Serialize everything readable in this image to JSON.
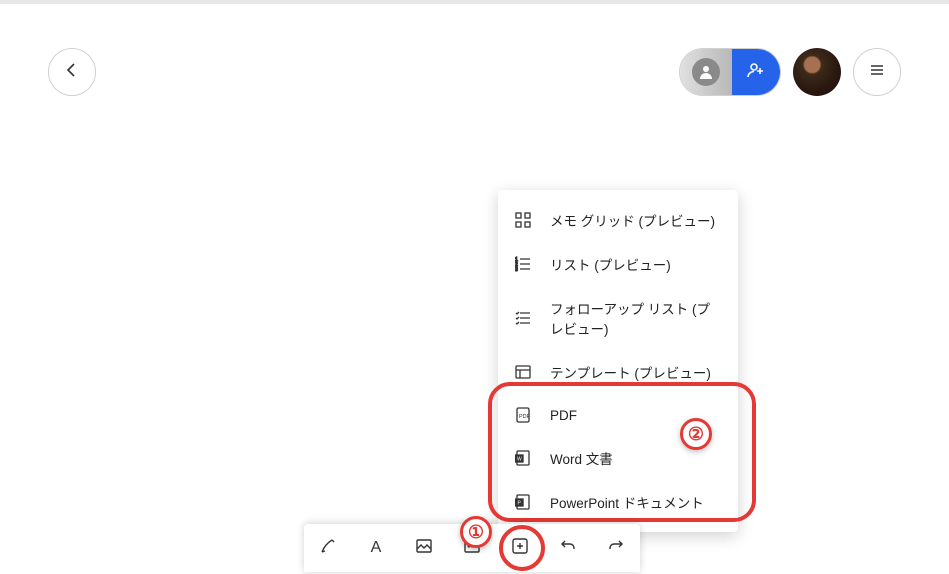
{
  "topbar": {
    "back": "←",
    "share": {
      "left_icon": "user",
      "right_icon": "user-add"
    },
    "avatar": "user-avatar",
    "menu": "hamburger"
  },
  "popup": {
    "items": [
      {
        "icon": "grid-icon",
        "label": "メモ グリッド (プレビュー)"
      },
      {
        "icon": "list-icon",
        "label": "リスト (プレビュー)"
      },
      {
        "icon": "followup-list-icon",
        "label": "フォローアップ リスト (プレビュー)"
      },
      {
        "icon": "template-icon",
        "label": "テンプレート (プレビュー)"
      },
      {
        "icon": "pdf-icon",
        "label": "PDF"
      },
      {
        "icon": "word-icon",
        "label": "Word 文書"
      },
      {
        "icon": "powerpoint-icon",
        "label": "PowerPoint ドキュメント"
      }
    ]
  },
  "toolbar": {
    "buttons": [
      {
        "name": "pen-tool",
        "icon": "pen"
      },
      {
        "name": "text-tool",
        "icon": "A"
      },
      {
        "name": "image-tool",
        "icon": "image"
      },
      {
        "name": "more-tool",
        "icon": "more"
      },
      {
        "name": "add-tool",
        "icon": "plus"
      },
      {
        "name": "undo-tool",
        "icon": "undo"
      },
      {
        "name": "redo-tool",
        "icon": "redo"
      }
    ]
  },
  "annotations": {
    "marker1": "①",
    "marker2": "②"
  }
}
